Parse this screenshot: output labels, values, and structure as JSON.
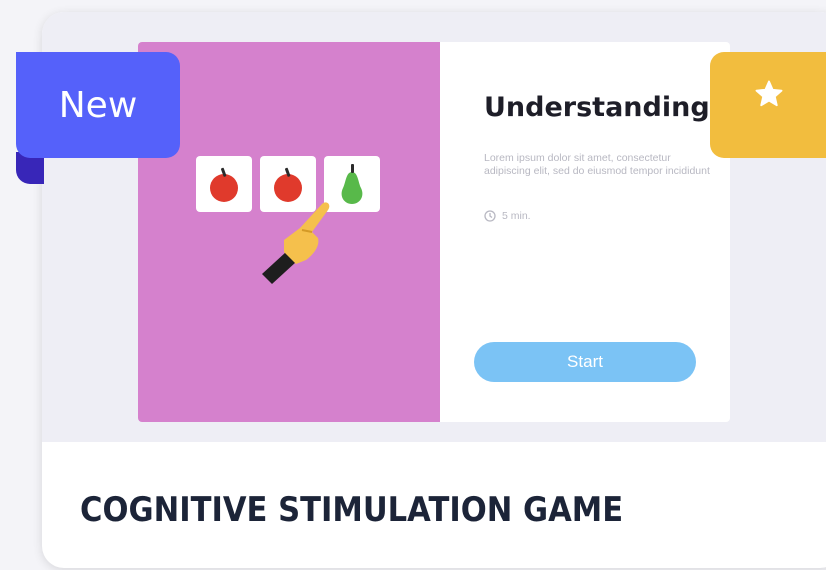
{
  "badge": {
    "label": "New"
  },
  "favorite": {
    "icon": "star-icon",
    "color": "#f2bd3e"
  },
  "preview": {
    "title": "Understanding",
    "description": "Lorem ipsum dolor sit amet, consectetur adipiscing elit, sed do eiusmod tempor incididunt",
    "duration": "5 min.",
    "start_label": "Start",
    "fruits": [
      "apple",
      "apple",
      "pear"
    ],
    "colors": {
      "left_panel": "#d581cd",
      "start_button": "#7bc3f5"
    }
  },
  "card": {
    "title": "COGNITIVE STIMULATION GAME"
  },
  "colors": {
    "badge": "#5561fa",
    "ribbon_fold": "#3826b8"
  }
}
